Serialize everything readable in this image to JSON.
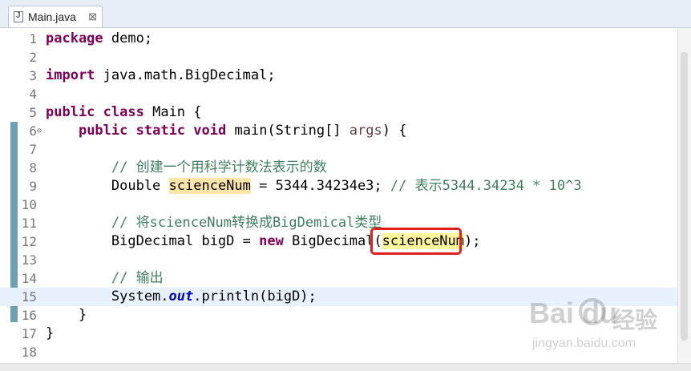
{
  "tab": {
    "title": "Main.java",
    "close_glyph": "⊠"
  },
  "lines": [
    {
      "n": "1",
      "tokens": [
        {
          "t": "package",
          "c": "kw"
        },
        {
          "t": " demo;"
        }
      ]
    },
    {
      "n": "2",
      "tokens": []
    },
    {
      "n": "3",
      "tokens": [
        {
          "t": "import",
          "c": "kw"
        },
        {
          "t": " java.math.BigDecimal;"
        }
      ]
    },
    {
      "n": "4",
      "tokens": []
    },
    {
      "n": "5",
      "tokens": [
        {
          "t": "public",
          "c": "kw"
        },
        {
          "t": " "
        },
        {
          "t": "class",
          "c": "kw"
        },
        {
          "t": " Main {"
        }
      ]
    },
    {
      "n": "6",
      "fold": "⊖",
      "tokens": [
        {
          "t": "    "
        },
        {
          "t": "public",
          "c": "kw"
        },
        {
          "t": " "
        },
        {
          "t": "static",
          "c": "kw"
        },
        {
          "t": " "
        },
        {
          "t": "void",
          "c": "kw"
        },
        {
          "t": " main(String[] "
        },
        {
          "t": "args",
          "c": "par"
        },
        {
          "t": ") {"
        }
      ]
    },
    {
      "n": "7",
      "tokens": []
    },
    {
      "n": "8",
      "tokens": [
        {
          "t": "        "
        },
        {
          "t": "// 创建一个用科学计数法表示的数",
          "c": "cm"
        }
      ]
    },
    {
      "n": "9",
      "tokens": [
        {
          "t": "        Double "
        },
        {
          "t": "scienceNum",
          "c": "occ"
        },
        {
          "t": " = 5344.34234e3; "
        },
        {
          "t": "// 表示5344.34234 * 10^3",
          "c": "cm"
        }
      ]
    },
    {
      "n": "10",
      "tokens": []
    },
    {
      "n": "11",
      "tokens": [
        {
          "t": "        "
        },
        {
          "t": "// 将scienceNum转换成BigDemical类型",
          "c": "cm"
        }
      ]
    },
    {
      "n": "12",
      "tokens": [
        {
          "t": "        BigDecimal bigD = "
        },
        {
          "t": "new",
          "c": "kw"
        },
        {
          "t": " BigDecimal("
        },
        {
          "t": "scienceNum",
          "c": "occ2"
        },
        {
          "t": ");"
        }
      ]
    },
    {
      "n": "13",
      "tokens": []
    },
    {
      "n": "14",
      "tokens": [
        {
          "t": "        "
        },
        {
          "t": "// 输出",
          "c": "cm"
        }
      ]
    },
    {
      "n": "15",
      "current": true,
      "tokens": [
        {
          "t": "        System."
        },
        {
          "t": "out",
          "c": "fld"
        },
        {
          "t": ".println(bigD);"
        }
      ]
    },
    {
      "n": "16",
      "tokens": [
        {
          "t": "    }"
        }
      ]
    },
    {
      "n": "17",
      "tokens": [
        {
          "t": "}"
        }
      ]
    },
    {
      "n": "18",
      "tokens": []
    }
  ],
  "watermark": {
    "main": "Bai du",
    "cn": "经验",
    "sub": "jingyan.baidu.com"
  },
  "colors": {
    "keyword": "#7f0055",
    "comment": "#3f7f5f",
    "highlight": "#ffe6a8",
    "callout": "#e02020"
  }
}
